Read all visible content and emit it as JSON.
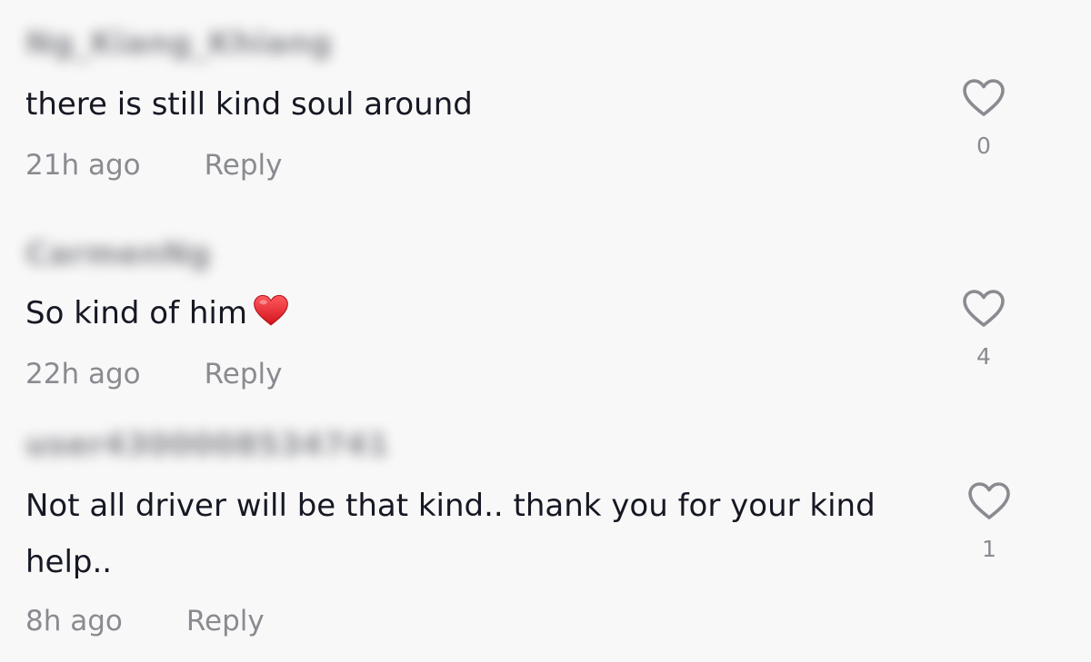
{
  "comments": [
    {
      "username": "Ng_Kiang_Khiang",
      "text": "there is still kind soul around",
      "time": "21h ago",
      "reply_label": "Reply",
      "likes": "0"
    },
    {
      "username": "CarmenNg",
      "text": "So kind of him",
      "emoji": "red-heart-emoji",
      "time": "22h ago",
      "reply_label": "Reply",
      "likes": "4"
    },
    {
      "username": "user4300008534741",
      "text": "Not all driver will be that kind.. thank you for your kind help..",
      "time": "8h ago",
      "reply_label": "Reply",
      "likes": "1"
    }
  ],
  "colors": {
    "background": "#f8f8f8",
    "text": "#161823",
    "secondary": "#8a8b91",
    "emoji_heart": "#e8262d"
  }
}
